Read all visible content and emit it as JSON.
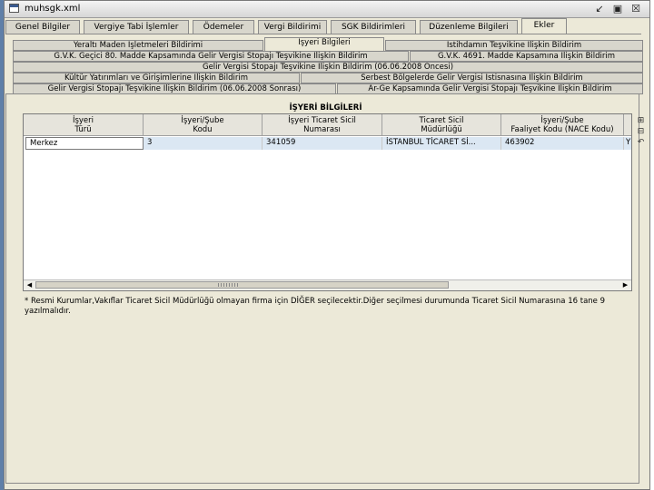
{
  "window": {
    "title": "muhsgk.xml"
  },
  "main_tabs": [
    {
      "label": "Genel Bilgiler"
    },
    {
      "label": "Vergiye Tabi İşlemler"
    },
    {
      "label": "Ödemeler"
    },
    {
      "label": "Vergi Bildirimi"
    },
    {
      "label": "SGK Bildirimleri"
    },
    {
      "label": "Düzenleme Bilgileri"
    },
    {
      "label": "Ekler"
    }
  ],
  "sub_tabs": {
    "row1": [
      "Yeraltı Maden İşletmeleri Bildirimi",
      "İşyeri Bilgileri",
      "İstihdamın Teşvikine İlişkin Bildirim"
    ],
    "row2": [
      "G.V.K. Geçici 80. Madde Kapsamında Gelir Vergisi Stopajı Teşvikine İlişkin Bildirim",
      "G.V.K. 4691. Madde Kapsamına İlişkin Bildirim"
    ],
    "row3": [
      "Gelir Vergisi Stopajı Teşvikine İlişkin Bildirim (06.06.2008 Öncesi)"
    ],
    "row4": [
      "Kültür Yatırımları ve Girişimlerine İlişkin Bildirim",
      "Serbest Bölgelerde Gelir Vergisi İstisnasına İlişkin Bildirim"
    ],
    "row5": [
      "Gelir Vergisi Stopajı Teşvikine İlişkin Bildirim (06.06.2008 Sonrası)",
      "Ar-Ge Kapsamında Gelir Vergisi Stopajı Teşvikine İlişkin Bildirim"
    ]
  },
  "grid": {
    "title": "İŞYERİ BİLGİLERİ",
    "columns": [
      {
        "line1": "İşyeri",
        "line2": "Türü"
      },
      {
        "line1": "İşyeri/Şube",
        "line2": "Kodu"
      },
      {
        "line1": "İşyeri Ticaret Sicil",
        "line2": "Numarası"
      },
      {
        "line1": "Ticaret Sicil",
        "line2": "Müdürlüğü"
      },
      {
        "line1": "İşyeri/Şube",
        "line2": "Faaliyet Kodu (NACE Kodu)"
      }
    ],
    "rows": [
      {
        "type": "Merkez",
        "code": "3",
        "registry_no": "341059",
        "registry_office": "İSTANBUL TİCARET Sİ...",
        "nace": "463902",
        "trailing": "Y"
      }
    ]
  },
  "side_buttons": [
    {
      "icon": "add-row-icon"
    },
    {
      "icon": "remove-row-icon"
    },
    {
      "icon": "undo-icon"
    }
  ],
  "note": "* Resmi Kurumlar,Vakıflar Ticaret Sicil Müdürlüğü olmayan firma için DİĞER seçilecektir.Diğer seçilmesi durumunda Ticaret Sicil Numarasına 16 tane 9 yazılmalıdır."
}
